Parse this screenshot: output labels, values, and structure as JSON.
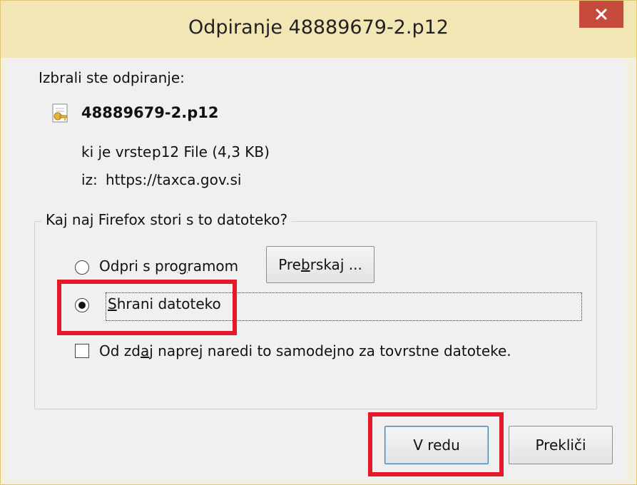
{
  "dialog": {
    "title": "Odpiranje 48889679-2.p12",
    "close_label": "✕",
    "intro": "Izbrali ste odpiranje:",
    "file_name": "48889679-2.p12",
    "type_label": "ki je vrste:",
    "type_value": "p12 File (4,3 KB)",
    "from_label": "iz:",
    "from_value": "https://taxca.gov.si",
    "group_title": "Kaj naj Firefox stori s to datoteko?",
    "open_with": {
      "label_pre": "Odpri s pro",
      "label_ul": "g",
      "label_post": "ramom",
      "selected": false
    },
    "browse_button": {
      "label_pre": "Pre",
      "label_ul": "b",
      "label_post": "rskaj ..."
    },
    "save_file": {
      "label_pre": "",
      "label_ul": "S",
      "label_post": "hrani datoteko",
      "selected": true
    },
    "remember": {
      "label_pre": "Od zd",
      "label_ul": "a",
      "label_post": "j naprej naredi to samodejno za tovrstne datoteke.",
      "checked": false
    },
    "ok_button": "V redu",
    "cancel_button": "Prekliči",
    "highlight_color": "#e21a2a"
  }
}
